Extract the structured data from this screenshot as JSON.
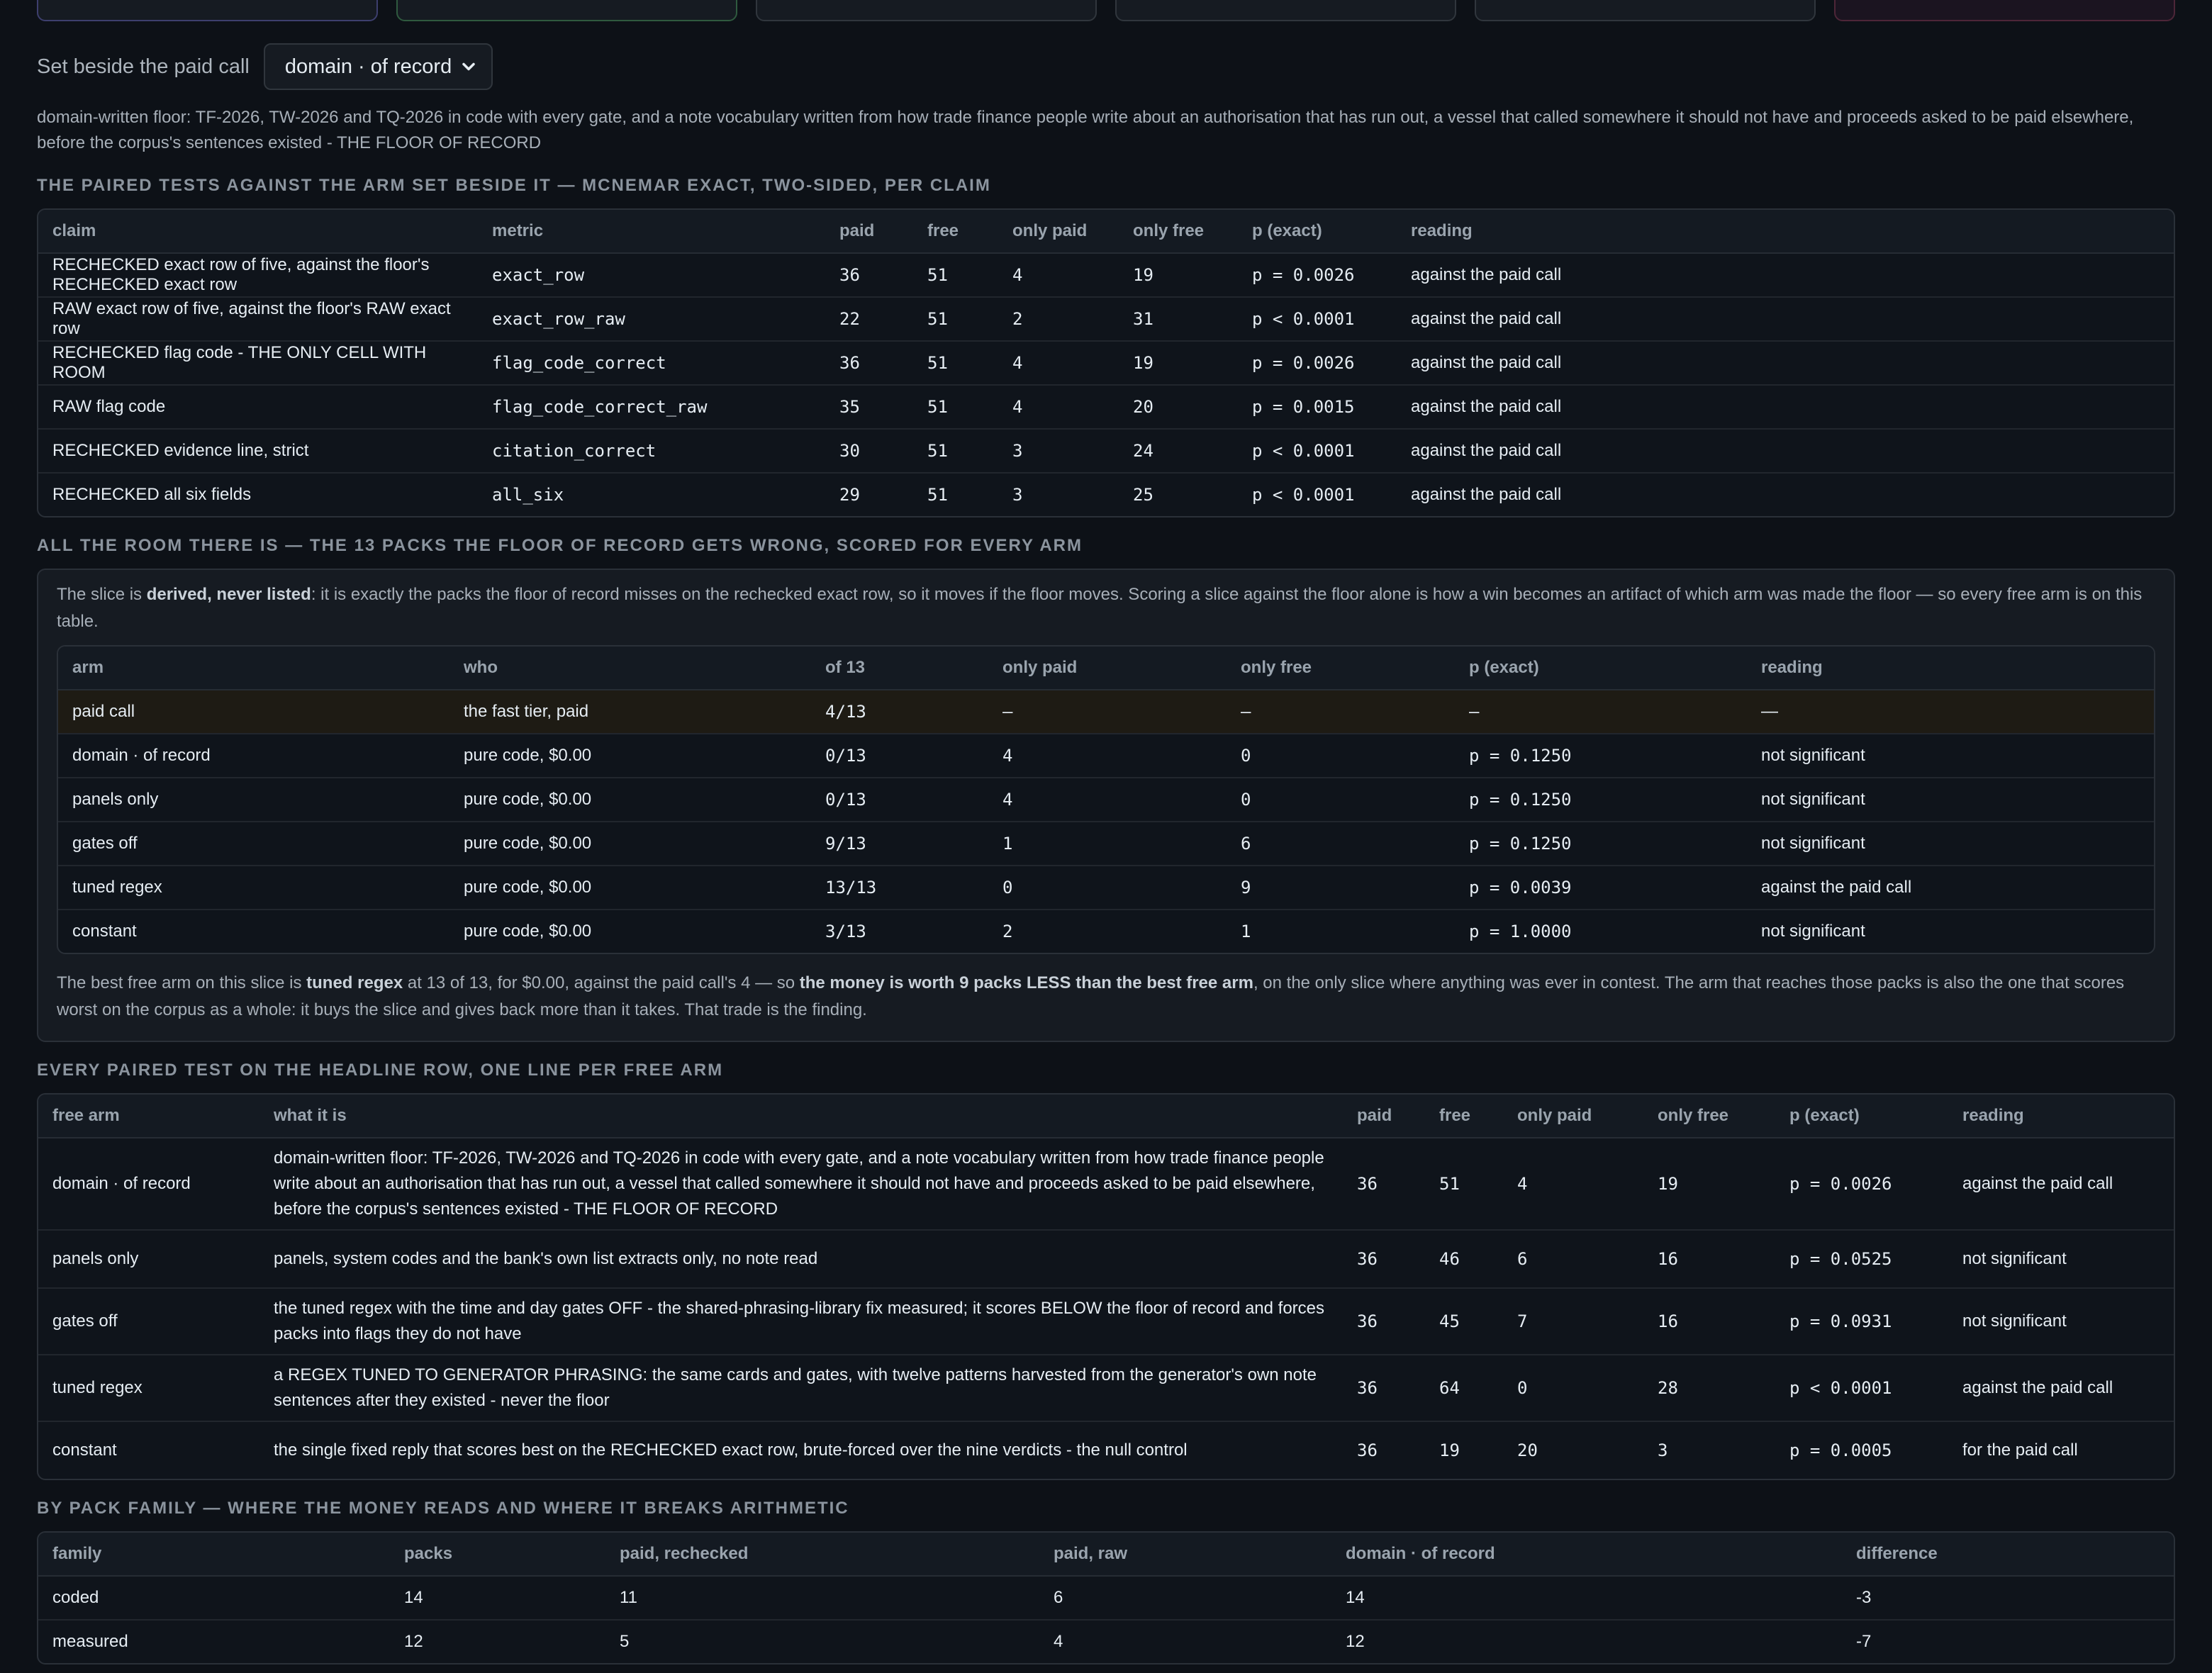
{
  "top_cards": [
    "",
    "",
    "",
    "",
    "",
    ""
  ],
  "selector": {
    "label": "Set beside the paid call",
    "value": "domain · of record"
  },
  "arm_description": "domain-written floor: TF-2026, TW-2026 and TQ-2026 in code with every gate, and a note vocabulary written from how trade finance people write about an authorisation that has run out, a vessel that called somewhere it should not have and proceeds asked to be paid elsewhere, before the corpus's sentences existed - THE FLOOR OF RECORD",
  "paired": {
    "heading": "THE PAIRED TESTS AGAINST THE ARM SET BESIDE IT — MCNEMAR EXACT, TWO-SIDED, PER CLAIM",
    "columns": [
      "claim",
      "metric",
      "paid",
      "free",
      "only paid",
      "only free",
      "p (exact)",
      "reading"
    ],
    "rows": [
      {
        "claim": "RECHECKED exact row of five, against the floor's RECHECKED exact row",
        "metric": "exact_row",
        "paid": "36",
        "free": "51",
        "only_paid": "4",
        "only_free": "19",
        "p": "p = 0.0026",
        "reading": "against the paid call"
      },
      {
        "claim": "RAW exact row of five, against the floor's RAW exact row",
        "metric": "exact_row_raw",
        "paid": "22",
        "free": "51",
        "only_paid": "2",
        "only_free": "31",
        "p": "p < 0.0001",
        "reading": "against the paid call"
      },
      {
        "claim": "RECHECKED flag code - THE ONLY CELL WITH ROOM",
        "metric": "flag_code_correct",
        "paid": "36",
        "free": "51",
        "only_paid": "4",
        "only_free": "19",
        "p": "p = 0.0026",
        "reading": "against the paid call"
      },
      {
        "claim": "RAW flag code",
        "metric": "flag_code_correct_raw",
        "paid": "35",
        "free": "51",
        "only_paid": "4",
        "only_free": "20",
        "p": "p = 0.0015",
        "reading": "against the paid call"
      },
      {
        "claim": "RECHECKED evidence line, strict",
        "metric": "citation_correct",
        "paid": "30",
        "free": "51",
        "only_paid": "3",
        "only_free": "24",
        "p": "p < 0.0001",
        "reading": "against the paid call"
      },
      {
        "claim": "RECHECKED all six fields",
        "metric": "all_six",
        "paid": "29",
        "free": "51",
        "only_paid": "3",
        "only_free": "25",
        "p": "p < 0.0001",
        "reading": "against the paid call"
      }
    ]
  },
  "room": {
    "heading": "ALL THE ROOM THERE IS — THE 13 PACKS THE FLOOR OF RECORD GETS WRONG, SCORED FOR EVERY ARM",
    "intro_pre": "The slice is ",
    "intro_bold": "derived, never listed",
    "intro_post": ": it is exactly the packs the floor of record misses on the rechecked exact row, so it moves if the floor moves. Scoring a slice against the floor alone is how a win becomes an artifact of which arm was made the floor — so every free arm is on this table.",
    "columns": [
      "arm",
      "who",
      "of 13",
      "only paid",
      "only free",
      "p (exact)",
      "reading"
    ],
    "rows": [
      {
        "arm": "paid call",
        "who": "the fast tier, paid",
        "of": "4/13",
        "only_paid": "—",
        "only_free": "—",
        "p": "—",
        "reading": "—"
      },
      {
        "arm": "domain · of record",
        "who": "pure code, $0.00",
        "of": "0/13",
        "only_paid": "4",
        "only_free": "0",
        "p": "p = 0.1250",
        "reading": "not significant"
      },
      {
        "arm": "panels only",
        "who": "pure code, $0.00",
        "of": "0/13",
        "only_paid": "4",
        "only_free": "0",
        "p": "p = 0.1250",
        "reading": "not significant"
      },
      {
        "arm": "gates off",
        "who": "pure code, $0.00",
        "of": "9/13",
        "only_paid": "1",
        "only_free": "6",
        "p": "p = 0.1250",
        "reading": "not significant"
      },
      {
        "arm": "tuned regex",
        "who": "pure code, $0.00",
        "of": "13/13",
        "only_paid": "0",
        "only_free": "9",
        "p": "p = 0.0039",
        "reading": "against the paid call"
      },
      {
        "arm": "constant",
        "who": "pure code, $0.00",
        "of": "3/13",
        "only_paid": "2",
        "only_free": "1",
        "p": "p = 1.0000",
        "reading": "not significant"
      }
    ],
    "outro_1": "The best free arm on this slice is ",
    "outro_b1": "tuned regex",
    "outro_2": " at 13 of 13, for $0.00, against the paid call's 4 — so ",
    "outro_b2": "the money is worth 9 packs LESS than the best free arm",
    "outro_3": ", on the only slice where anything was ever in contest. The arm that reaches those packs is also the one that scores worst on the corpus as a whole: it buys the slice and gives back more than it takes. That trade is the finding."
  },
  "headline": {
    "heading": "EVERY PAIRED TEST ON THE HEADLINE ROW, ONE LINE PER FREE ARM",
    "columns": [
      "free arm",
      "what it is",
      "paid",
      "free",
      "only paid",
      "only free",
      "p (exact)",
      "reading"
    ],
    "rows": [
      {
        "arm": "domain · of record",
        "what": "domain-written floor: TF-2026, TW-2026 and TQ-2026 in code with every gate, and a note vocabulary written from how trade finance people write about an authorisation that has run out, a vessel that called somewhere it should not have and proceeds asked to be paid elsewhere, before the corpus's sentences existed - THE FLOOR OF RECORD",
        "paid": "36",
        "free": "51",
        "only_paid": "4",
        "only_free": "19",
        "p": "p = 0.0026",
        "reading": "against the paid call"
      },
      {
        "arm": "panels only",
        "what": "panels, system codes and the bank's own list extracts only, no note read",
        "paid": "36",
        "free": "46",
        "only_paid": "6",
        "only_free": "16",
        "p": "p = 0.0525",
        "reading": "not significant"
      },
      {
        "arm": "gates off",
        "what": "the tuned regex with the time and day gates OFF - the shared-phrasing-library fix measured; it scores BELOW the floor of record and forces packs into flags they do not have",
        "paid": "36",
        "free": "45",
        "only_paid": "7",
        "only_free": "16",
        "p": "p = 0.0931",
        "reading": "not significant"
      },
      {
        "arm": "tuned regex",
        "what": "a REGEX TUNED TO GENERATOR PHRASING: the same cards and gates, with twelve patterns harvested from the generator's own note sentences after they existed - never the floor",
        "paid": "36",
        "free": "64",
        "only_paid": "0",
        "only_free": "28",
        "p": "p < 0.0001",
        "reading": "against the paid call"
      },
      {
        "arm": "constant",
        "what": "the single fixed reply that scores best on the RECHECKED exact row, brute-forced over the nine verdicts - the null control",
        "paid": "36",
        "free": "19",
        "only_paid": "20",
        "only_free": "3",
        "p": "p = 0.0005",
        "reading": "for the paid call"
      }
    ]
  },
  "family": {
    "heading": "BY PACK FAMILY — WHERE THE MONEY READS AND WHERE IT BREAKS ARITHMETIC",
    "columns": [
      "family",
      "packs",
      "paid, rechecked",
      "paid, raw",
      "domain · of record",
      "difference"
    ],
    "rows": [
      {
        "family": "coded",
        "packs": "14",
        "paid_rechecked": "11",
        "paid_raw": "6",
        "domain": "14",
        "difference": "-3"
      },
      {
        "family": "measured",
        "packs": "12",
        "paid_rechecked": "5",
        "paid_raw": "4",
        "domain": "12",
        "difference": "-7"
      }
    ]
  },
  "colors": {
    "negative": "#f47067",
    "neutral": "#e3b341",
    "positive": "#57c97a"
  }
}
